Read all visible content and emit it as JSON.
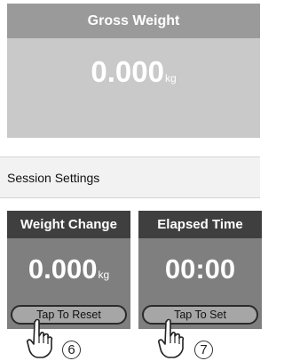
{
  "gross": {
    "title": "Gross Weight",
    "value": "0.000",
    "unit": "kg"
  },
  "session": {
    "title": "Session Settings"
  },
  "weight_change": {
    "title": "Weight Change",
    "value": "0.000",
    "unit": "kg",
    "button": "Tap To Reset"
  },
  "elapsed_time": {
    "title": "Elapsed Time",
    "value": "00:00",
    "button": "Tap To Set"
  },
  "markers": {
    "left": "6",
    "right": "7"
  },
  "icons": {
    "hand": "tap-hand-icon"
  }
}
